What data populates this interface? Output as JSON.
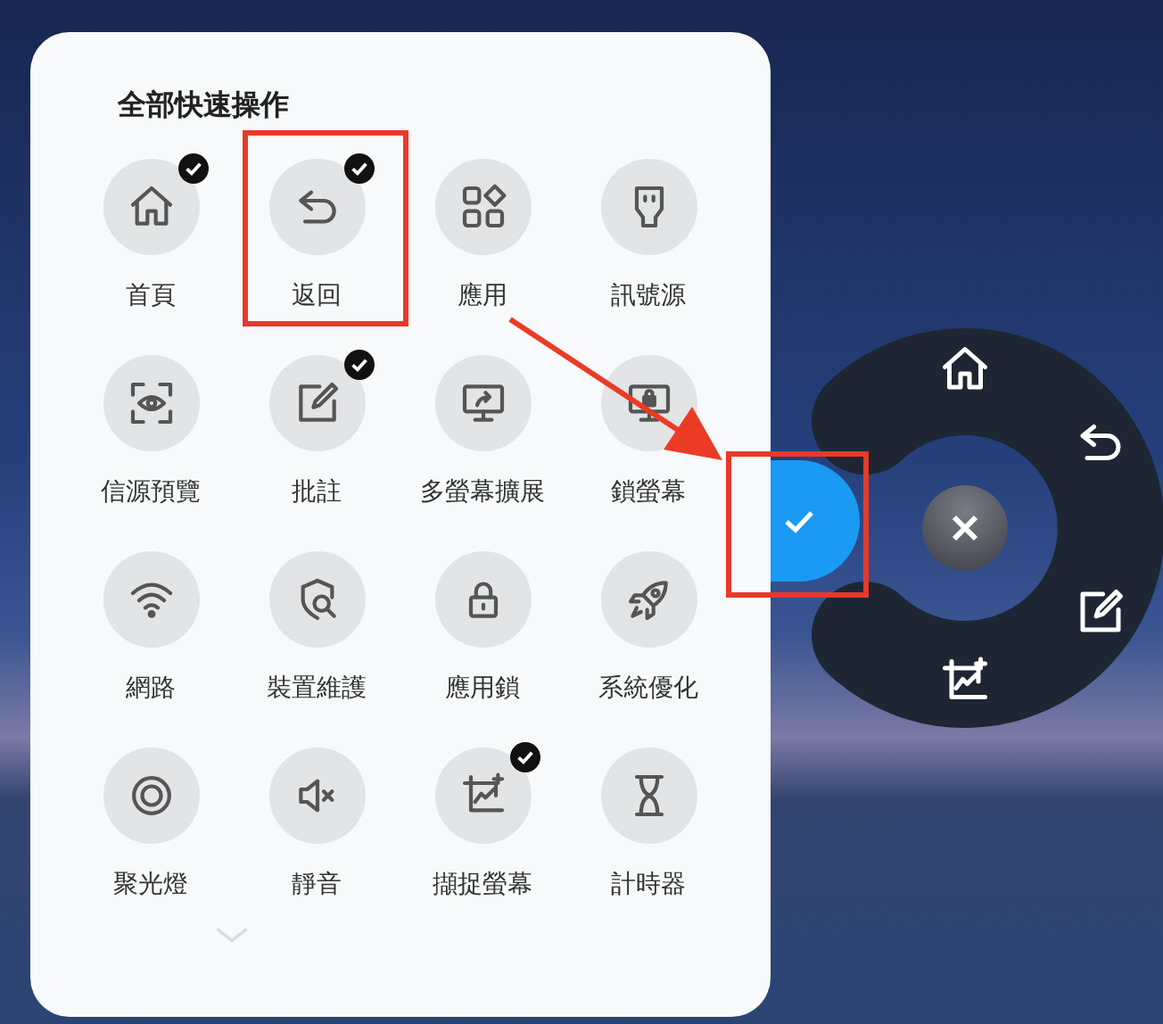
{
  "panel": {
    "title": "全部快速操作",
    "actions": [
      {
        "label": "首頁",
        "checked": true
      },
      {
        "label": "返回",
        "checked": true
      },
      {
        "label": "應用",
        "checked": false
      },
      {
        "label": "訊號源",
        "checked": false
      },
      {
        "label": "信源預覽",
        "checked": false
      },
      {
        "label": "批註",
        "checked": true
      },
      {
        "label": "多螢幕擴展",
        "checked": false
      },
      {
        "label": "鎖螢幕",
        "checked": false
      },
      {
        "label": "網路",
        "checked": false
      },
      {
        "label": "裝置維護",
        "checked": false
      },
      {
        "label": "應用鎖",
        "checked": false
      },
      {
        "label": "系統優化",
        "checked": false
      },
      {
        "label": "聚光燈",
        "checked": false
      },
      {
        "label": "靜音",
        "checked": false
      },
      {
        "label": "擷捉螢幕",
        "checked": true
      },
      {
        "label": "計時器",
        "checked": false
      }
    ]
  }
}
